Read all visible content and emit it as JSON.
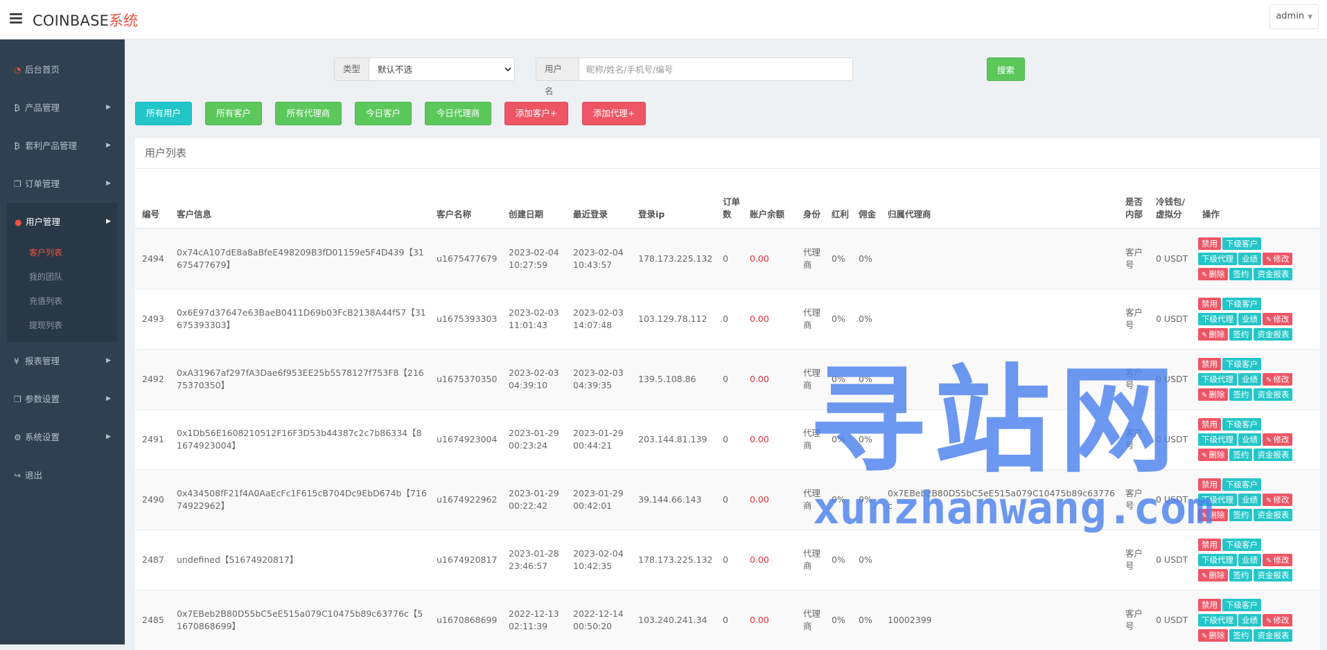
{
  "header": {
    "brand_prefix": "COINBASE",
    "brand_suffix": "系统",
    "user": "admin",
    "menu_icon": "hamburger-icon"
  },
  "sidebar": {
    "items": [
      {
        "label": "后台首页",
        "icon": "dashboard-icon"
      },
      {
        "label": "产品管理",
        "icon": "bitcoin-icon"
      },
      {
        "label": "套利产品管理",
        "icon": "bitcoin-icon"
      },
      {
        "label": "订单管理",
        "icon": "copy-icon"
      },
      {
        "label": "用户管理",
        "icon": "user-icon"
      },
      {
        "label": "报表管理",
        "icon": "yen-icon"
      },
      {
        "label": "参数设置",
        "icon": "copy-icon"
      },
      {
        "label": "系统设置",
        "icon": "cogs-icon"
      },
      {
        "label": "退出",
        "icon": "sign-out-icon"
      }
    ],
    "sub_items": [
      "客户列表",
      "我的团队",
      "充值列表",
      "提现列表"
    ]
  },
  "search": {
    "type_label": "类型",
    "type_value": "默认不选",
    "username_label": "用户名",
    "username_placeholder": "昵称/姓名/手机号/编号",
    "button": "搜索"
  },
  "filters": [
    "所有用户",
    "所有客户",
    "所有代理商",
    "今日客户",
    "今日代理商",
    "添加客户+",
    "添加代理+"
  ],
  "panel_title": "用户列表",
  "table": {
    "headers": {
      "id": "编号",
      "info": "客户信息",
      "name": "客户名称",
      "created": "创建日期",
      "last_login": "最近登录",
      "ip": "登录ip",
      "orders": "订单数",
      "balance": "账户余额",
      "identity": "身份",
      "bonus": "红利",
      "commission": "佣金",
      "agent": "归属代理商",
      "internal": "是否内部",
      "cold": "冷钱包/虚拟分",
      "ops": "操作"
    },
    "rows": [
      {
        "id": "2494",
        "addr": "0x74cA107dE8a8aBfeE498209B3fD01159e5F4D439",
        "code": "【31675477679】",
        "name": "u1675477679",
        "created_date": "2023-02-04",
        "created_time": "10:27:59",
        "login_date": "2023-02-04",
        "login_time": "10:43:57",
        "ip": "178.173.225.132",
        "orders": "0",
        "balance": "0.00",
        "identity": "代理商",
        "bonus": "0%",
        "commission": "0%",
        "agent": "",
        "internal": "客户号",
        "cold": "0 USDT"
      },
      {
        "id": "2493",
        "addr": "0x6E97d37647e63BaeB0411D69b03FcB2138A44f57",
        "code": "【31675393303】",
        "name": "u1675393303",
        "created_date": "2023-02-03",
        "created_time": "11:01:43",
        "login_date": "2023-02-03",
        "login_time": "14:07:48",
        "ip": "103.129.78.112",
        "orders": "0",
        "balance": "0.00",
        "identity": "代理商",
        "bonus": "0%",
        "commission": "0%",
        "agent": "",
        "internal": "客户号",
        "cold": "0 USDT"
      },
      {
        "id": "2492",
        "addr": "0xA31967af297fA3Dae6f953EE25b5578127f753F8",
        "code": "【21675370350】",
        "name": "u1675370350",
        "created_date": "2023-02-03",
        "created_time": "04:39:10",
        "login_date": "2023-02-03",
        "login_time": "04:39:35",
        "ip": "139.5.108.86",
        "orders": "0",
        "balance": "0.00",
        "identity": "代理商",
        "bonus": "0%",
        "commission": "0%",
        "agent": "",
        "internal": "客户号",
        "cold": "0 USDT"
      },
      {
        "id": "2491",
        "addr": "0x1Db56E1608210512F16F3D53b44387c2c7b86334",
        "code": "【81674923004】",
        "name": "u1674923004",
        "created_date": "2023-01-29",
        "created_time": "00:23:24",
        "login_date": "2023-01-29",
        "login_time": "00:44:21",
        "ip": "203.144.81.139",
        "orders": "0",
        "balance": "0.00",
        "identity": "代理商",
        "bonus": "0%",
        "commission": "0%",
        "agent": "",
        "internal": "客户号",
        "cold": "0 USDT"
      },
      {
        "id": "2490",
        "addr": "0x434508fF21f4A0AaEcFc1F615cB704Dc9EbD674b",
        "code": "【71674922962】",
        "name": "u1674922962",
        "created_date": "2023-01-29",
        "created_time": "00:22:42",
        "login_date": "2023-01-29",
        "login_time": "00:42:01",
        "ip": "39.144.66.143",
        "orders": "0",
        "balance": "0.00",
        "identity": "代理商",
        "bonus": "0%",
        "commission": "0%",
        "agent": "0x7EBeb2B80D55bC5eE515a079C10475b89c63776c",
        "internal": "客户号",
        "cold": "0 USDT"
      },
      {
        "id": "2487",
        "addr": "undefined",
        "code": "【51674920817】",
        "name": "u1674920817",
        "created_date": "2023-01-28",
        "created_time": "23:46:57",
        "login_date": "2023-02-04",
        "login_time": "10:42:35",
        "ip": "178.173.225.132",
        "orders": "0",
        "balance": "0.00",
        "identity": "代理商",
        "bonus": "0%",
        "commission": "0%",
        "agent": "",
        "internal": "客户号",
        "cold": "0 USDT"
      },
      {
        "id": "2485",
        "addr": "0x7EBeb2B80D55bC5eE515a079C10475b89c63776c",
        "code": "【51670868699】",
        "name": "u1670868699",
        "created_date": "2022-12-13",
        "created_time": "02:11:39",
        "login_date": "2022-12-14",
        "login_time": "00:50:20",
        "ip": "103.240.241.34",
        "orders": "0",
        "balance": "0.00",
        "identity": "代理商",
        "bonus": "0%",
        "commission": "0%",
        "agent": "10002399",
        "internal": "客户号",
        "cold": "0 USDT"
      }
    ],
    "actions": {
      "disable": "禁用",
      "sub_customer": "下级客户",
      "sub_agent": "下级代理",
      "performance": "业绩",
      "edit": "修改",
      "delete": "删除",
      "sign": "签约",
      "fund_report": "资金报表"
    }
  },
  "watermark": {
    "cn": "寻站网",
    "en": "xunzhanwang.com"
  },
  "colors": {
    "sidebar_bg": "#2f4050",
    "accent_red": "#e8543f",
    "teal": "#23c6c8",
    "green": "#5cc85c",
    "danger": "#ed5565",
    "watermark": "#4d82ee"
  }
}
